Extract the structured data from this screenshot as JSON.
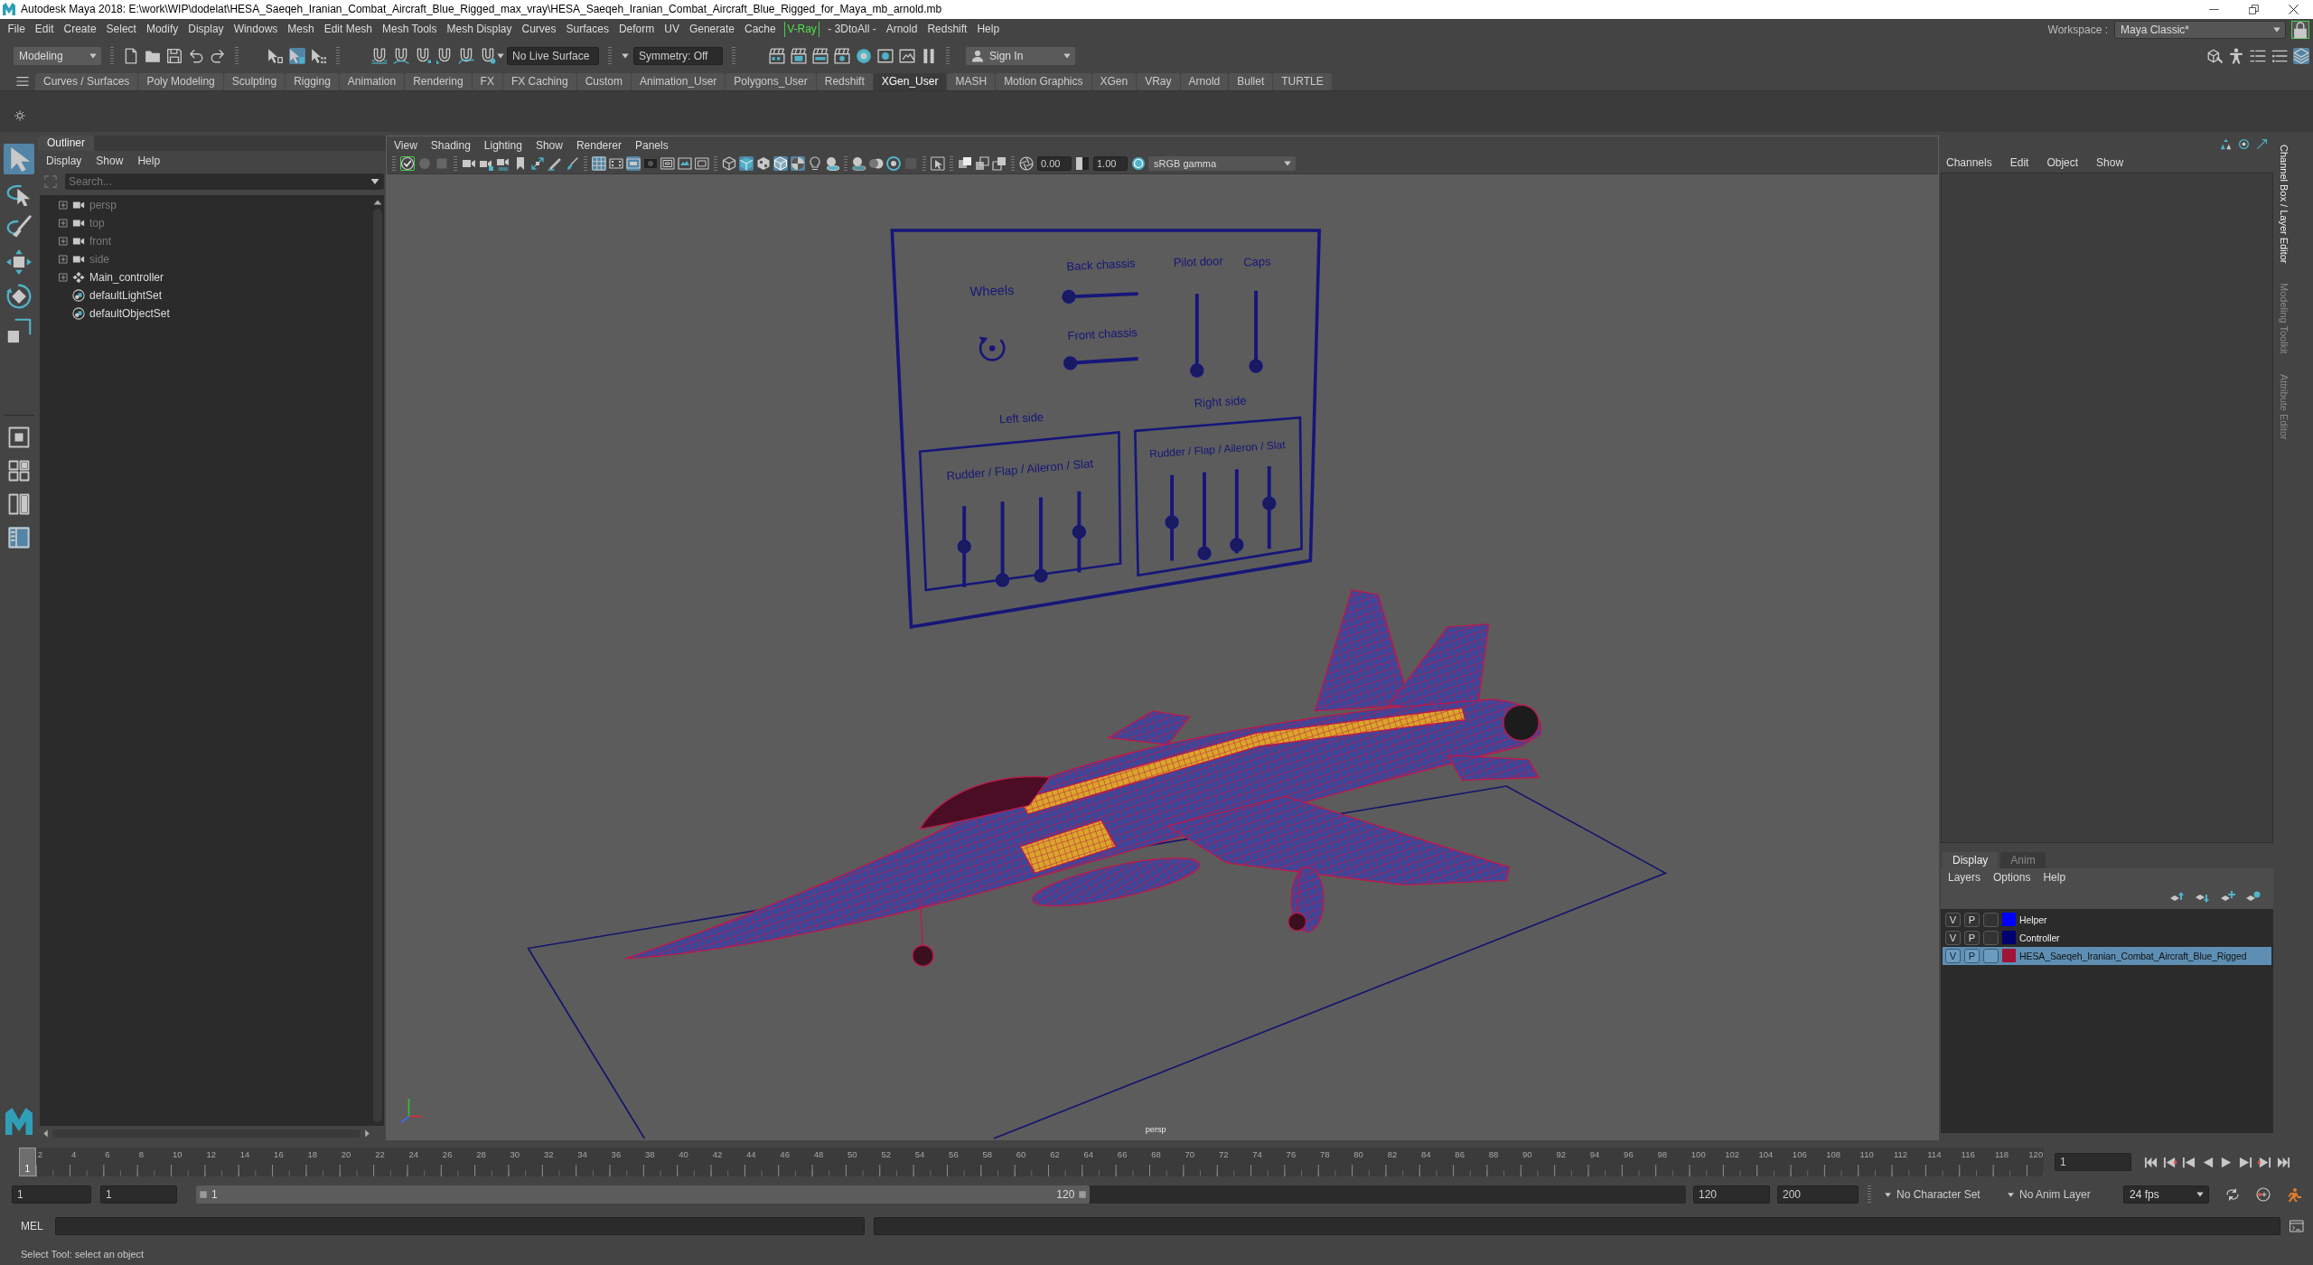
{
  "window": {
    "title": "Autodesk Maya 2018: E:\\work\\WIP\\dodelat\\HESA_Saeqeh_Iranian_Combat_Aircraft_Blue_Rigged_max_vray\\HESA_Saeqeh_Iranian_Combat_Aircraft_Blue_Rigged_for_Maya_mb_arnold.mb"
  },
  "menu_bar": {
    "items": [
      {
        "label": "File",
        "highlighted": false
      },
      {
        "label": "Edit",
        "highlighted": false
      },
      {
        "label": "Create",
        "highlighted": false
      },
      {
        "label": "Select",
        "highlighted": false
      },
      {
        "label": "Modify",
        "highlighted": false
      },
      {
        "label": "Display",
        "highlighted": false
      },
      {
        "label": "Windows",
        "highlighted": false
      },
      {
        "label": "Mesh",
        "highlighted": false
      },
      {
        "label": "Edit Mesh",
        "highlighted": false
      },
      {
        "label": "Mesh Tools",
        "highlighted": false
      },
      {
        "label": "Mesh Display",
        "highlighted": false
      },
      {
        "label": "Curves",
        "highlighted": false
      },
      {
        "label": "Surfaces",
        "highlighted": false
      },
      {
        "label": "Deform",
        "highlighted": false
      },
      {
        "label": "UV",
        "highlighted": false
      },
      {
        "label": "Generate",
        "highlighted": false
      },
      {
        "label": "Cache",
        "highlighted": false
      },
      {
        "label": "V-Ray",
        "highlighted": true
      },
      {
        "label": "- 3DtoAll -",
        "highlighted": false
      },
      {
        "label": "Arnold",
        "highlighted": false
      },
      {
        "label": "Redshift",
        "highlighted": false
      },
      {
        "label": "Help",
        "highlighted": false
      }
    ],
    "workspace_label": "Workspace :",
    "workspace": "Maya Classic*",
    "workspace_locked": true
  },
  "status_line": {
    "mode": "Modeling",
    "select_modes": [
      {
        "on": false
      },
      {
        "on": true
      },
      {
        "on": false
      }
    ],
    "live_surface": "No Live Surface",
    "symmetry": "Symmetry: Off",
    "sign_in": "Sign In",
    "panel_toggles": [
      {
        "on": false
      },
      {
        "on": false
      },
      {
        "on": false
      },
      {
        "on": false
      },
      {
        "on": true
      }
    ]
  },
  "shelf": {
    "tabs": [
      {
        "label": "Curves / Surfaces",
        "selected": false
      },
      {
        "label": "Poly Modeling",
        "selected": false
      },
      {
        "label": "Sculpting",
        "selected": false
      },
      {
        "label": "Rigging",
        "selected": false
      },
      {
        "label": "Animation",
        "selected": false
      },
      {
        "label": "Rendering",
        "selected": false
      },
      {
        "label": "FX",
        "selected": false
      },
      {
        "label": "FX Caching",
        "selected": false
      },
      {
        "label": "Custom",
        "selected": false
      },
      {
        "label": "Animation_User",
        "selected": false
      },
      {
        "label": "Polygons_User",
        "selected": false
      },
      {
        "label": "Redshift",
        "selected": false
      },
      {
        "label": "XGen_User",
        "selected": true
      },
      {
        "label": "MASH",
        "selected": false
      },
      {
        "label": "Motion Graphics",
        "selected": false
      },
      {
        "label": "XGen",
        "selected": false
      },
      {
        "label": "VRay",
        "selected": false
      },
      {
        "label": "Arnold",
        "selected": false
      },
      {
        "label": "Bullet",
        "selected": false
      },
      {
        "label": "TURTLE",
        "selected": false
      }
    ]
  },
  "toolbox": {
    "tools": [
      {
        "selected": true
      },
      {
        "selected": false
      },
      {
        "selected": false
      },
      {
        "selected": false
      },
      {
        "selected": false
      },
      {
        "selected": false
      }
    ],
    "layouts": [
      {
        "selected": false
      },
      {
        "selected": false
      },
      {
        "selected": false
      },
      {
        "selected": true
      }
    ]
  },
  "outliner": {
    "title": "Outliner",
    "menu": [
      "Display",
      "Show",
      "Help"
    ],
    "search_placeholder": "Search...",
    "items": [
      {
        "label": "persp",
        "kind": "camera",
        "expandable": true,
        "dimmed": true
      },
      {
        "label": "top",
        "kind": "camera",
        "expandable": true,
        "dimmed": true
      },
      {
        "label": "front",
        "kind": "camera",
        "expandable": true,
        "dimmed": true
      },
      {
        "label": "side",
        "kind": "camera",
        "expandable": true,
        "dimmed": true
      },
      {
        "label": "Main_controller",
        "kind": "transform",
        "expandable": true,
        "dimmed": false
      },
      {
        "label": "defaultLightSet",
        "kind": "set",
        "expandable": false,
        "dimmed": false
      },
      {
        "label": "defaultObjectSet",
        "kind": "set",
        "expandable": false,
        "dimmed": false
      }
    ]
  },
  "viewport": {
    "menu": [
      "View",
      "Shading",
      "Lighting",
      "Show",
      "Renderer",
      "Panels"
    ],
    "toolbar": [
      [
        {
          "on": true
        },
        {
          "on": false
        },
        {
          "on": false
        }
      ],
      [
        {
          "on": false
        },
        {
          "on": false
        },
        {
          "on": false
        },
        {
          "on": false
        },
        {
          "on": false
        },
        {
          "on": false
        },
        {
          "on": false
        }
      ],
      [
        {
          "on": true
        },
        {
          "on": false
        },
        {
          "on": true
        },
        {
          "on": false
        },
        {
          "on": false
        },
        {
          "on": false
        },
        {
          "on": false
        }
      ],
      [
        {
          "on": false
        },
        {
          "on": true
        },
        {
          "on": false
        },
        {
          "on": true
        },
        {
          "on": true
        },
        {
          "on": false
        },
        {
          "on": false
        }
      ],
      [
        {
          "on": false
        },
        {
          "on": false
        },
        {
          "on": false
        },
        {
          "on": false
        }
      ],
      [
        {
          "on": false
        }
      ],
      [
        {
          "on": false
        },
        {
          "on": false
        },
        {
          "on": false
        }
      ]
    ],
    "exposure": "0.00",
    "gamma": "1.00",
    "color_management": true,
    "color_space": "sRGB gamma",
    "scene": {
      "panel": {
        "wheels": "Wheels",
        "chassis": [
          {
            "label": "Back chassis",
            "level": 0
          },
          {
            "label": "Front chassis",
            "level": 0
          }
        ],
        "doors": [
          {
            "label": "Pilot door",
            "level": 0
          },
          {
            "label": "Caps",
            "level": 0
          }
        ],
        "sides": [
          {
            "label": "Left side",
            "title": "Rudder / Flap / Aileron / Slat",
            "sliders": [
              {
                "level": 0.5
              },
              {
                "level": 0.05
              },
              {
                "level": 0.05
              },
              {
                "level": 0.5
              }
            ]
          },
          {
            "label": "Right side",
            "title": "Rudder / Flap / Aileron / Slat",
            "sliders": [
              {
                "level": 0.45
              },
              {
                "level": 0.05
              },
              {
                "level": 0.1
              },
              {
                "level": 0.55
              }
            ]
          }
        ]
      },
      "camera_label": "persp"
    }
  },
  "channel_box": {
    "menu": [
      "Channels",
      "Edit",
      "Object",
      "Show"
    ]
  },
  "layer_editor": {
    "tabs": [
      {
        "label": "Display",
        "selected": true
      },
      {
        "label": "Anim",
        "selected": false
      }
    ],
    "menu": [
      "Layers",
      "Options",
      "Help"
    ],
    "layers": [
      {
        "visibility": "V",
        "playback": "P",
        "name": "Helper",
        "color": "#0000ff",
        "selected": false
      },
      {
        "visibility": "V",
        "playback": "P",
        "name": "Controller",
        "color": "#000070",
        "selected": false
      },
      {
        "visibility": "V",
        "playback": "P",
        "name": "HESA_Saeqeh_Iranian_Combat_Aircraft_Blue_Rigged",
        "color": "#a01438",
        "selected": true
      }
    ]
  },
  "side_tabs": [
    {
      "label": "Channel Box / Layer Editor",
      "selected": true
    },
    {
      "label": "Modeling Toolkit",
      "selected": false
    },
    {
      "label": "Attribute Editor",
      "selected": false
    }
  ],
  "time_slider": {
    "current_frame": "1",
    "level": 0,
    "ticks": [
      "2",
      "4",
      "6",
      "8",
      "10",
      "12",
      "14",
      "16",
      "18",
      "20",
      "22",
      "24",
      "26",
      "28",
      "30",
      "32",
      "34",
      "36",
      "38",
      "40",
      "42",
      "44",
      "46",
      "48",
      "50",
      "52",
      "54",
      "56",
      "58",
      "60",
      "62",
      "64",
      "66",
      "68",
      "70",
      "72",
      "74",
      "76",
      "78",
      "80",
      "82",
      "84",
      "86",
      "88",
      "90",
      "92",
      "94",
      "96",
      "98",
      "100",
      "102",
      "104",
      "106",
      "108",
      "110",
      "112",
      "114",
      "116",
      "118",
      "120"
    ],
    "frame_field": "1"
  },
  "range_slider": {
    "start_field": "1",
    "range_start_field": "1",
    "range_start": "1",
    "range_end": "120",
    "level": 0.6,
    "range_end_field": "120",
    "end_field": "200",
    "character_set": "No Character Set",
    "anim_layer": "No Anim Layer",
    "fps": "24 fps"
  },
  "command_line": {
    "language": "MEL"
  },
  "help_line": {
    "text": "Select Tool: select an object"
  }
}
